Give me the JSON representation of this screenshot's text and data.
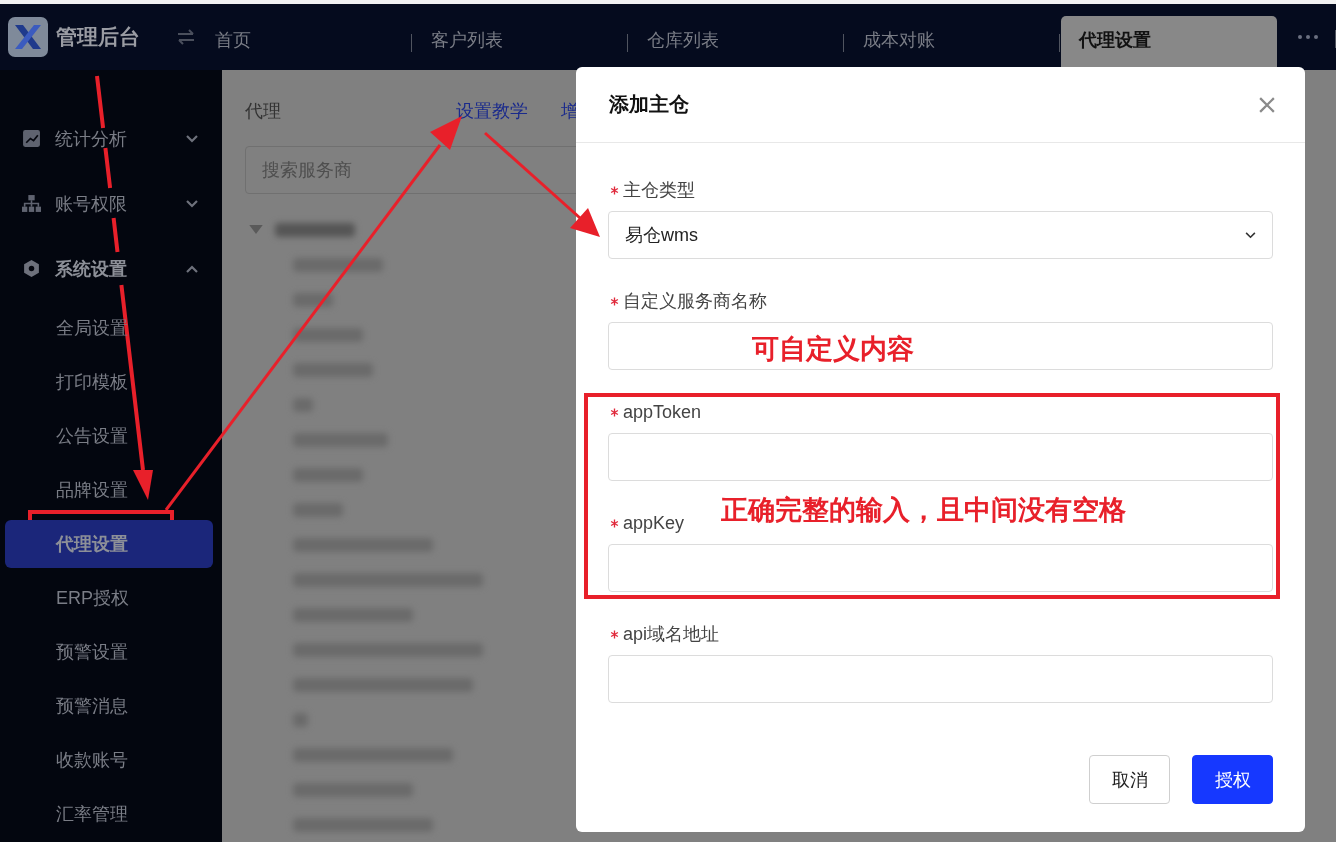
{
  "brand": {
    "title": "管理后台"
  },
  "tabs": [
    {
      "label": "首页",
      "selected": false
    },
    {
      "label": "客户列表",
      "selected": false
    },
    {
      "label": "仓库列表",
      "selected": false
    },
    {
      "label": "成本对账",
      "selected": false
    },
    {
      "label": "代理设置",
      "selected": true
    }
  ],
  "sidebar": {
    "items": [
      {
        "label": "统计分析",
        "expanded": false
      },
      {
        "label": "账号权限",
        "expanded": false
      },
      {
        "label": "系统设置",
        "expanded": true,
        "children": [
          {
            "label": "全局设置",
            "selected": false
          },
          {
            "label": "打印模板",
            "selected": false
          },
          {
            "label": "公告设置",
            "selected": false
          },
          {
            "label": "品牌设置",
            "selected": false
          },
          {
            "label": "代理设置",
            "selected": true
          },
          {
            "label": "ERP授权",
            "selected": false
          },
          {
            "label": "预警设置",
            "selected": false
          },
          {
            "label": "预警消息",
            "selected": false
          },
          {
            "label": "收款账号",
            "selected": false
          },
          {
            "label": "汇率管理",
            "selected": false
          }
        ]
      }
    ]
  },
  "content": {
    "title": "代理",
    "links": [
      "设置教学",
      "增"
    ],
    "search": {
      "placeholder": "搜索服务商"
    }
  },
  "dialog": {
    "title": "添加主仓",
    "fields": [
      {
        "label": "主仓类型",
        "required": true,
        "kind": "select",
        "value": "易仓wms"
      },
      {
        "label": "自定义服务商名称",
        "required": true,
        "kind": "input"
      },
      {
        "label": "appToken",
        "required": true,
        "kind": "input"
      },
      {
        "label": "appKey",
        "required": true,
        "kind": "input"
      },
      {
        "label": "api域名地址",
        "required": true,
        "kind": "input"
      }
    ],
    "buttons": [
      {
        "label": "取消",
        "kind": "default"
      },
      {
        "label": "授权",
        "kind": "primary"
      }
    ]
  },
  "annotations": [
    {
      "text": "可自定义内容"
    },
    {
      "text": "正确完整的输入，且中间没有空格"
    }
  ]
}
